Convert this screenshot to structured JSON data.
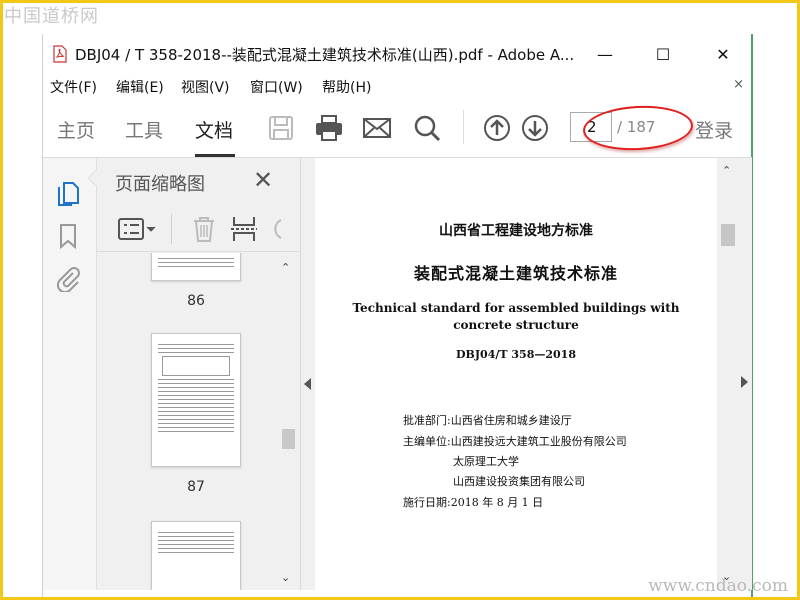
{
  "watermarks": {
    "top": "中国道桥网",
    "bottom": "www.cndao.com"
  },
  "window": {
    "title": "DBJ04 / T 358-2018--装配式混凝土建筑技术标准(山西).pdf - Adobe A...",
    "minimize": "—",
    "maximize": "☐",
    "close": "✕"
  },
  "menu": {
    "items": [
      "文件(F)",
      "编辑(E)",
      "视图(V)",
      "窗口(W)",
      "帮助(H)"
    ],
    "close_doc": "×"
  },
  "toolbar": {
    "tabs": [
      "主页",
      "工具",
      "文档"
    ],
    "active_tab": "文档",
    "current_page": "2",
    "page_total": "/ 187",
    "login": "登录"
  },
  "panel": {
    "title": "页面缩略图",
    "close": "✕",
    "thumbnails": [
      {
        "label": "86"
      },
      {
        "label": "87"
      },
      {
        "label": ""
      }
    ]
  },
  "document": {
    "heading1": "山西省工程建设地方标准",
    "heading2": "装配式混凝土建筑技术标准",
    "english1": "Technical standard for assembled buildings with",
    "english2": "concrete structure",
    "code": "DBJ04/T 358—2018",
    "approval": "批准部门:山西省住房和城乡建设厅",
    "editor": "主编单位:山西建投远大建筑工业股份有限公司",
    "editor2": "太原理工大学",
    "editor3": "山西建设投资集团有限公司",
    "date": "施行日期:2018 年 8 月 1 日"
  },
  "colors": {
    "frame": "#f2c718",
    "highlight_ellipse": "#e02020",
    "window_right_border": "#4ca26a",
    "accent_icon": "#1e72c8"
  }
}
